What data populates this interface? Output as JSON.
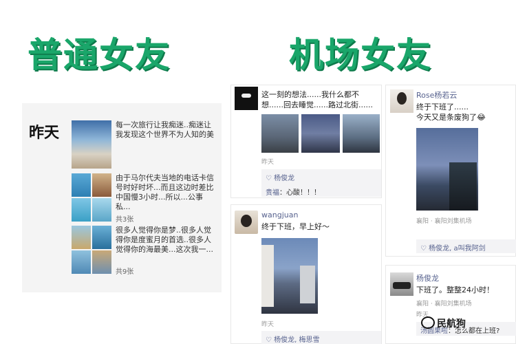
{
  "titles": {
    "left": "普通女友",
    "right": "机场女友"
  },
  "left_panel": {
    "date": "昨天",
    "rows": [
      {
        "text": "每一次旅行让我痴迷..痴迷让我发现这个世界不为人知的美",
        "count": ""
      },
      {
        "text": "由于马尔代夫当地的电话卡信号时好时坏...而且这边时差比中国慢3小时...所以...公事私...",
        "count": "共3张"
      },
      {
        "text": "很多人觉得你是梦..很多人觉得你是度蜜月的首选..很多人觉得你的海最美...这次我一...",
        "count": "共9张"
      }
    ]
  },
  "post1": {
    "text": "这一刻的想法......我什么都不想......回去睡觉......路过北街......",
    "time": "昨天",
    "likes": "杨俊龙",
    "comment_author": "贵福",
    "comment_text": "心酸！！！"
  },
  "post2": {
    "user": "wangjuan",
    "text": "终于下班，早上好～",
    "time": "昨天",
    "likes": "杨俊龙, 梅思雪"
  },
  "post3": {
    "user": "Rose杨若云",
    "text_line1": "终于下班了......",
    "text_line2": "今天又是条废狗了😂",
    "location": "襄阳 · 襄阳刘集机场",
    "likes": "杨俊龙, a叫我阿剑"
  },
  "post4": {
    "user": "杨俊龙",
    "text": "下班了。整整24小时！",
    "location": "襄阳 · 襄阳刘集机场",
    "time": "昨天",
    "comment_author": "汤圆果啦",
    "comment_text": "怎么都在上班?"
  },
  "watermark": "民航狗",
  "colors": {
    "title_green": "#1aa66a",
    "link_blue": "#57628e"
  }
}
